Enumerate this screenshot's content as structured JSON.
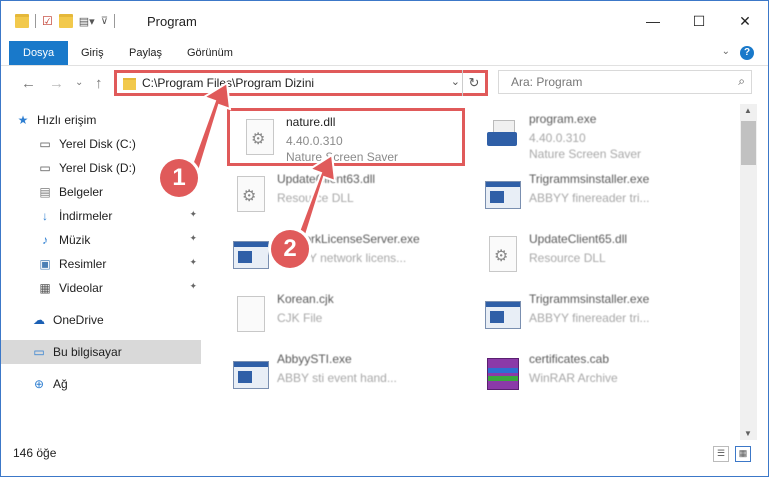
{
  "window": {
    "title": "Program",
    "controls": {
      "minimize": "—",
      "maximize": "☐",
      "close": "✕"
    }
  },
  "ribbon": {
    "tabs": [
      "Dosya",
      "Giriş",
      "Paylaş",
      "Görünüm"
    ],
    "help": "?"
  },
  "address": {
    "path": "C:\\Program Files\\Program Dizini",
    "dropdown": "⌄",
    "refresh": "↻"
  },
  "search": {
    "placeholder": "Ara: Program",
    "icon": "⌕"
  },
  "nav": {
    "back": "←",
    "forward": "→",
    "history": "⌄",
    "up": "↑"
  },
  "sidebar": {
    "items": [
      {
        "label": "Hızlı erişim",
        "icon": "★"
      },
      {
        "label": "Yerel Disk (C:)",
        "icon": "▭"
      },
      {
        "label": "Yerel Disk (D:)",
        "icon": "▭"
      },
      {
        "label": "Belgeler",
        "icon": "▤"
      },
      {
        "label": "İndirmeler",
        "icon": "↓"
      },
      {
        "label": "Müzik",
        "icon": "♪"
      },
      {
        "label": "Resimler",
        "icon": "▣"
      },
      {
        "label": "Videolar",
        "icon": "▦"
      },
      {
        "label": "OneDrive",
        "icon": "☁"
      },
      {
        "label": "Bu bilgisayar",
        "icon": "▭"
      },
      {
        "label": "Ağ",
        "icon": "⊕"
      }
    ],
    "pin": "📌"
  },
  "files": [
    {
      "name": "nature.dll",
      "version": "4.40.0.310",
      "desc": "Nature Screen Saver"
    },
    {
      "name": "program.exe",
      "version": "4.40.0.310",
      "desc": "Nature Screen Saver"
    },
    {
      "name": "UpdateClient63.dll",
      "version": "Resource DLL",
      "desc": ""
    },
    {
      "name": "Trigrammsinstaller.exe",
      "version": "ABBYY finereader tri...",
      "desc": ""
    },
    {
      "name": "NetworkLicenseServer.exe",
      "version": "ABBYY network licens...",
      "desc": ""
    },
    {
      "name": "UpdateClient65.dll",
      "version": "Resource DLL",
      "desc": ""
    },
    {
      "name": "Korean.cjk",
      "version": "CJK File",
      "desc": ""
    },
    {
      "name": "Trigrammsinstaller.exe",
      "version": "ABBYY finereader tri...",
      "desc": ""
    },
    {
      "name": "AbbyySTI.exe",
      "version": "ABBY sti event hand...",
      "desc": ""
    },
    {
      "name": "certificates.cab",
      "version": "WinRAR Archive",
      "desc": ""
    }
  ],
  "status": {
    "count": "146 öğe"
  },
  "annotations": {
    "step1": "1",
    "step2": "2"
  },
  "colors": {
    "accent": "#1979ca",
    "highlight": "#e05a5a"
  }
}
